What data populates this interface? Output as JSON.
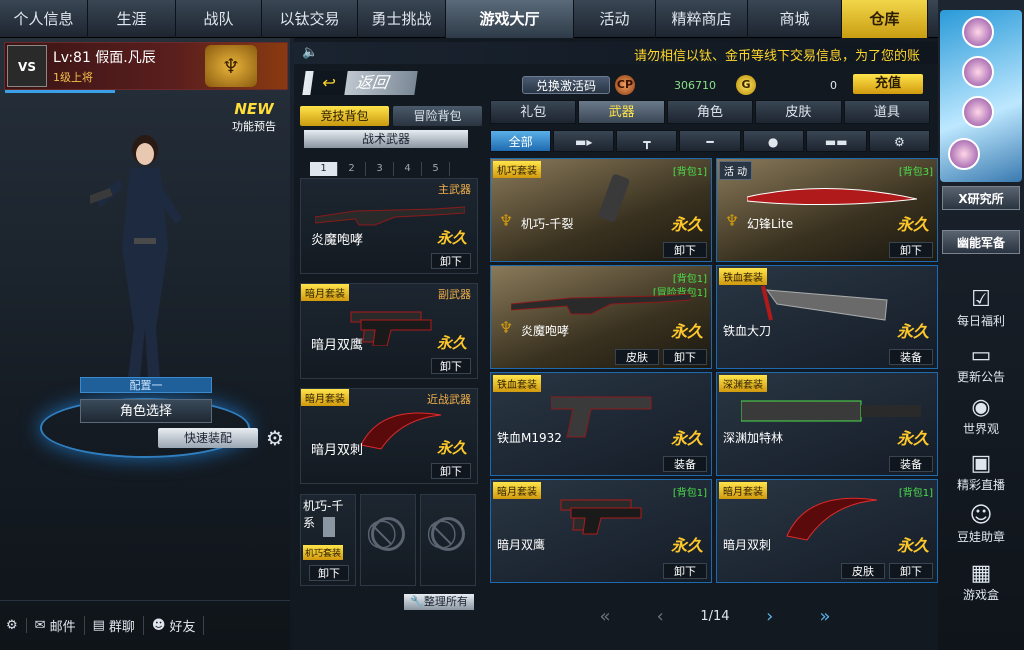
{
  "nav": {
    "tabs": [
      "个人信息",
      "生涯",
      "战队",
      "以钛交易",
      "勇士挑战",
      "游戏大厅",
      "活动",
      "精粹商店",
      "商城",
      "仓库"
    ]
  },
  "player": {
    "level_name": "Lv:81 假面.凡辰",
    "rank": "1级上将",
    "logo": "VS"
  },
  "new_badge": {
    "new": "NEW",
    "text": "功能预告"
  },
  "left": {
    "config_label": "配置一",
    "role_select": "角色选择",
    "quick_equip": "快速装配"
  },
  "bottom_bar": {
    "mail": "邮件",
    "group_chat": "群聊",
    "friends": "好友"
  },
  "notice": {
    "text": "请勿相信以钛、金币等线下交易信息，为了您的账"
  },
  "header": {
    "back": "返回",
    "redeem": "兑换激活码",
    "cp_icon": "CP",
    "cp_value": "306710",
    "gold_icon": "G",
    "gold_value": "0",
    "recharge": "充值"
  },
  "pack": {
    "tabs": [
      "竞技背包",
      "冒险背包"
    ],
    "tactical": "战术武器",
    "pages": [
      "1",
      "2",
      "3",
      "4",
      "5"
    ],
    "slots": [
      {
        "category": "主武器",
        "tag": "",
        "name": "炎魔咆哮",
        "perm": "永久",
        "action": "卸下"
      },
      {
        "category": "副武器",
        "tag": "暗月套装",
        "name": "暗月双鹰",
        "perm": "永久",
        "action": "卸下"
      },
      {
        "category": "近战武器",
        "tag": "暗月套装",
        "name": "暗月双刺",
        "perm": "永久",
        "action": "卸下"
      }
    ],
    "mini_slot": {
      "name": "机巧-千系",
      "tag": "机巧套装",
      "action": "卸下"
    },
    "tidy": "整理所有"
  },
  "warehouse": {
    "tabs": [
      "礼包",
      "武器",
      "角色",
      "皮肤",
      "道具"
    ],
    "filters": [
      "全部",
      "rifle-icon",
      "pistol-icon",
      "knife-icon",
      "grenade-icon",
      "special-icon",
      "gear-icon"
    ],
    "cards": [
      {
        "tag": "机巧套装",
        "bag": "[背包1]",
        "name": "机巧-千裂",
        "perm": "永久",
        "buttons": [
          "卸下"
        ]
      },
      {
        "tag": "活 动",
        "bag": "[背包3]",
        "name": "幻锋Lite",
        "perm": "永久",
        "buttons": [
          "卸下"
        ]
      },
      {
        "tag": "",
        "bag": "[背包1]",
        "bag2": "[冒险背包1]",
        "name": "炎魔咆哮",
        "perm": "永久",
        "buttons": [
          "皮肤",
          "卸下"
        ]
      },
      {
        "tag": "铁血套装",
        "bag": "",
        "name": "铁血大刀",
        "perm": "永久",
        "buttons": [
          "装备"
        ]
      },
      {
        "tag": "铁血套装",
        "bag": "",
        "name": "铁血M1932",
        "perm": "永久",
        "buttons": [
          "装备"
        ]
      },
      {
        "tag": "深渊套装",
        "bag": "",
        "name": "深渊加特林",
        "perm": "永久",
        "buttons": [
          "装备"
        ]
      },
      {
        "tag": "暗月套装",
        "bag": "[背包1]",
        "name": "暗月双鹰",
        "perm": "永久",
        "buttons": [
          "卸下"
        ]
      },
      {
        "tag": "暗月套装",
        "bag": "[背包1]",
        "name": "暗月双刺",
        "perm": "永久",
        "buttons": [
          "皮肤",
          "卸下"
        ]
      }
    ],
    "page": "1/14"
  },
  "right_side": {
    "x_lab": "X研究所",
    "mech": "幽能军备",
    "items": [
      "每日福利",
      "更新公告",
      "世界观",
      "精彩直播",
      "豆娃助章",
      "游戏盒"
    ]
  }
}
